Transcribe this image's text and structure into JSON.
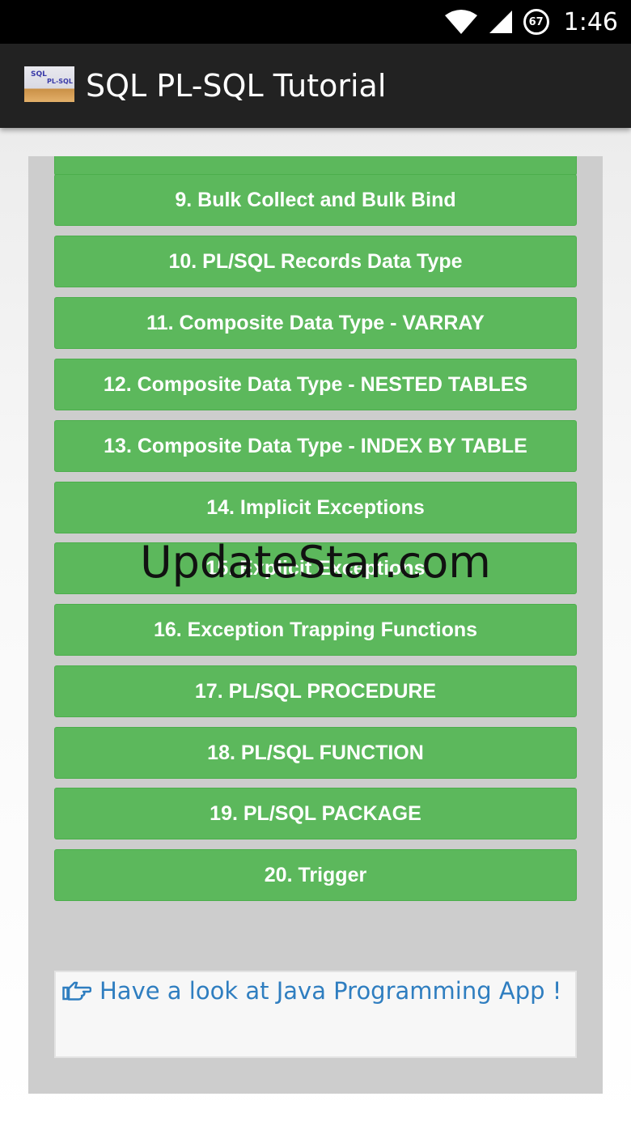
{
  "status_bar": {
    "battery_level": "67",
    "time": "1:46"
  },
  "app_bar": {
    "logo_line1": "SQL",
    "logo_line2": "PL-SQL",
    "title": "SQL PL-SQL Tutorial"
  },
  "topics": [
    "9. Bulk Collect and Bulk Bind",
    "10. PL/SQL Records Data Type",
    "11. Composite Data Type - VARRAY",
    "12. Composite Data Type - NESTED TABLES",
    "13. Composite Data Type - INDEX BY TABLE",
    "14. Implicit Exceptions",
    "15. Explicit Exceptions",
    "16. Exception Trapping Functions",
    "17. PL/SQL PROCEDURE",
    "18. PL/SQL FUNCTION",
    "19. PL/SQL PACKAGE",
    "20. Trigger"
  ],
  "promo": {
    "icon": "hand-point-right-icon",
    "link_text": "Have a look at Java Programming App !"
  },
  "watermark": "UpdateStar.com",
  "colors": {
    "button_green": "#5cb85c",
    "panel_gray": "#cdcdcd",
    "link_blue": "#2f7ec0",
    "app_bar": "#222222"
  }
}
